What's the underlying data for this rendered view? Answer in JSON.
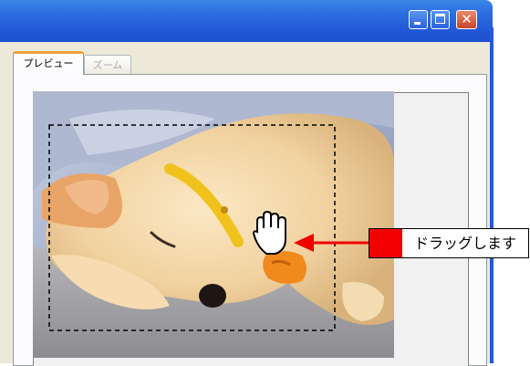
{
  "window": {
    "close_glyph": "✕",
    "controls": [
      "minimize-icon",
      "maximize-icon",
      "close-icon"
    ]
  },
  "tabs": [
    {
      "label": "プレビュー",
      "active": true
    },
    {
      "label": "ズーム",
      "active": false
    }
  ],
  "annotation": {
    "label": "ドラッグします",
    "marker_color": "#f20000",
    "arrow_color": "#f20000"
  },
  "preview": {
    "subject": "sleeping-puppy-photo",
    "selection_marquee": "dashed",
    "cursor": "hand-grab-icon"
  },
  "colors": {
    "titlebar": "#2259d8",
    "dialog": "#ece9d8",
    "active_tab_accent": "#f1a23d"
  }
}
